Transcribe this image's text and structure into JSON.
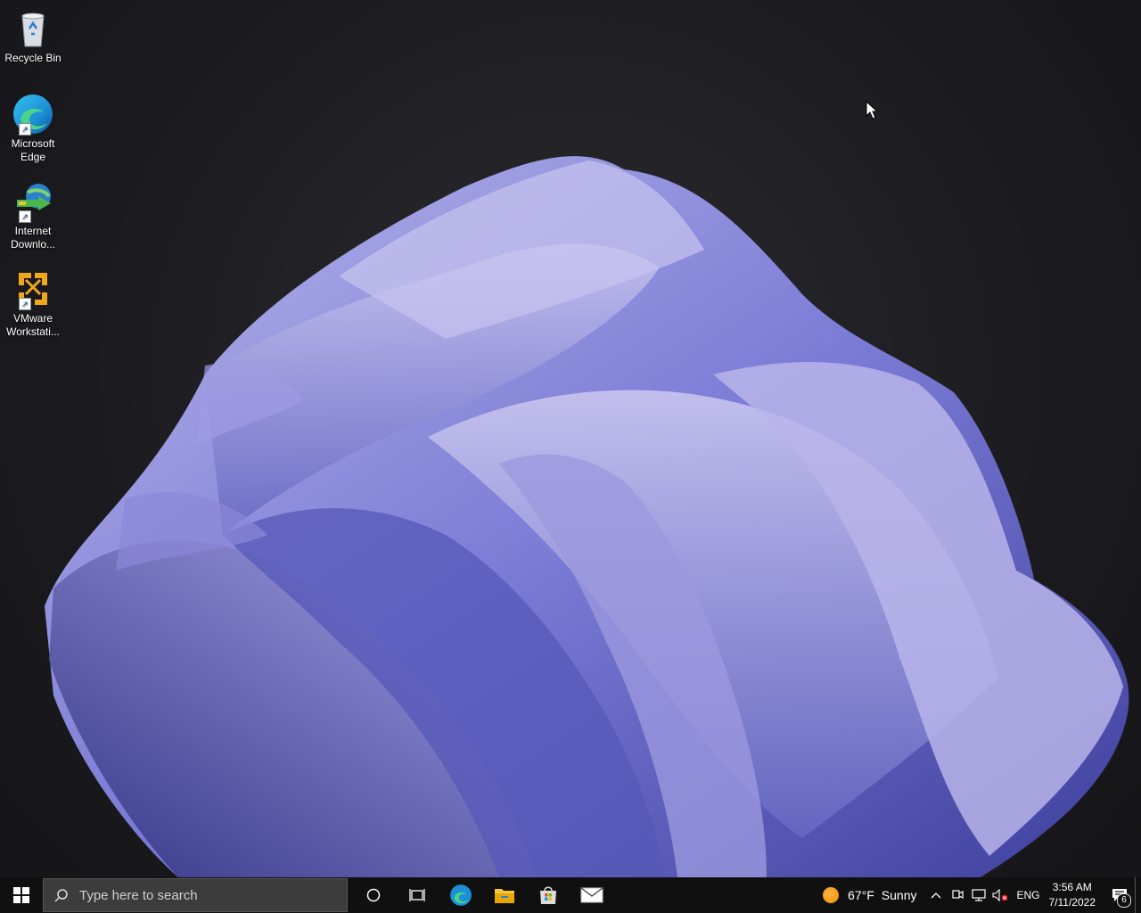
{
  "desktop_icons": [
    {
      "label": "Recycle Bin",
      "icon": "recycle-bin-icon"
    },
    {
      "label": "Microsoft Edge",
      "icon": "edge-icon"
    },
    {
      "label": "Internet Downlo...",
      "icon": "internet-download-manager-icon"
    },
    {
      "label": "VMware Workstati...",
      "icon": "vmware-icon"
    }
  ],
  "taskbar": {
    "search_placeholder": "Type here to search",
    "pinned": [
      "cortana-icon",
      "task-view-icon",
      "edge-icon",
      "file-explorer-icon",
      "microsoft-store-icon",
      "mail-icon"
    ]
  },
  "tray": {
    "temperature": "67°F",
    "condition": "Sunny",
    "language": "ENG",
    "time": "3:56 AM",
    "date": "7/11/2022",
    "notification_count": "6"
  },
  "colors": {
    "accent": "#6b6cc9",
    "taskbar_bg": "#101010"
  }
}
